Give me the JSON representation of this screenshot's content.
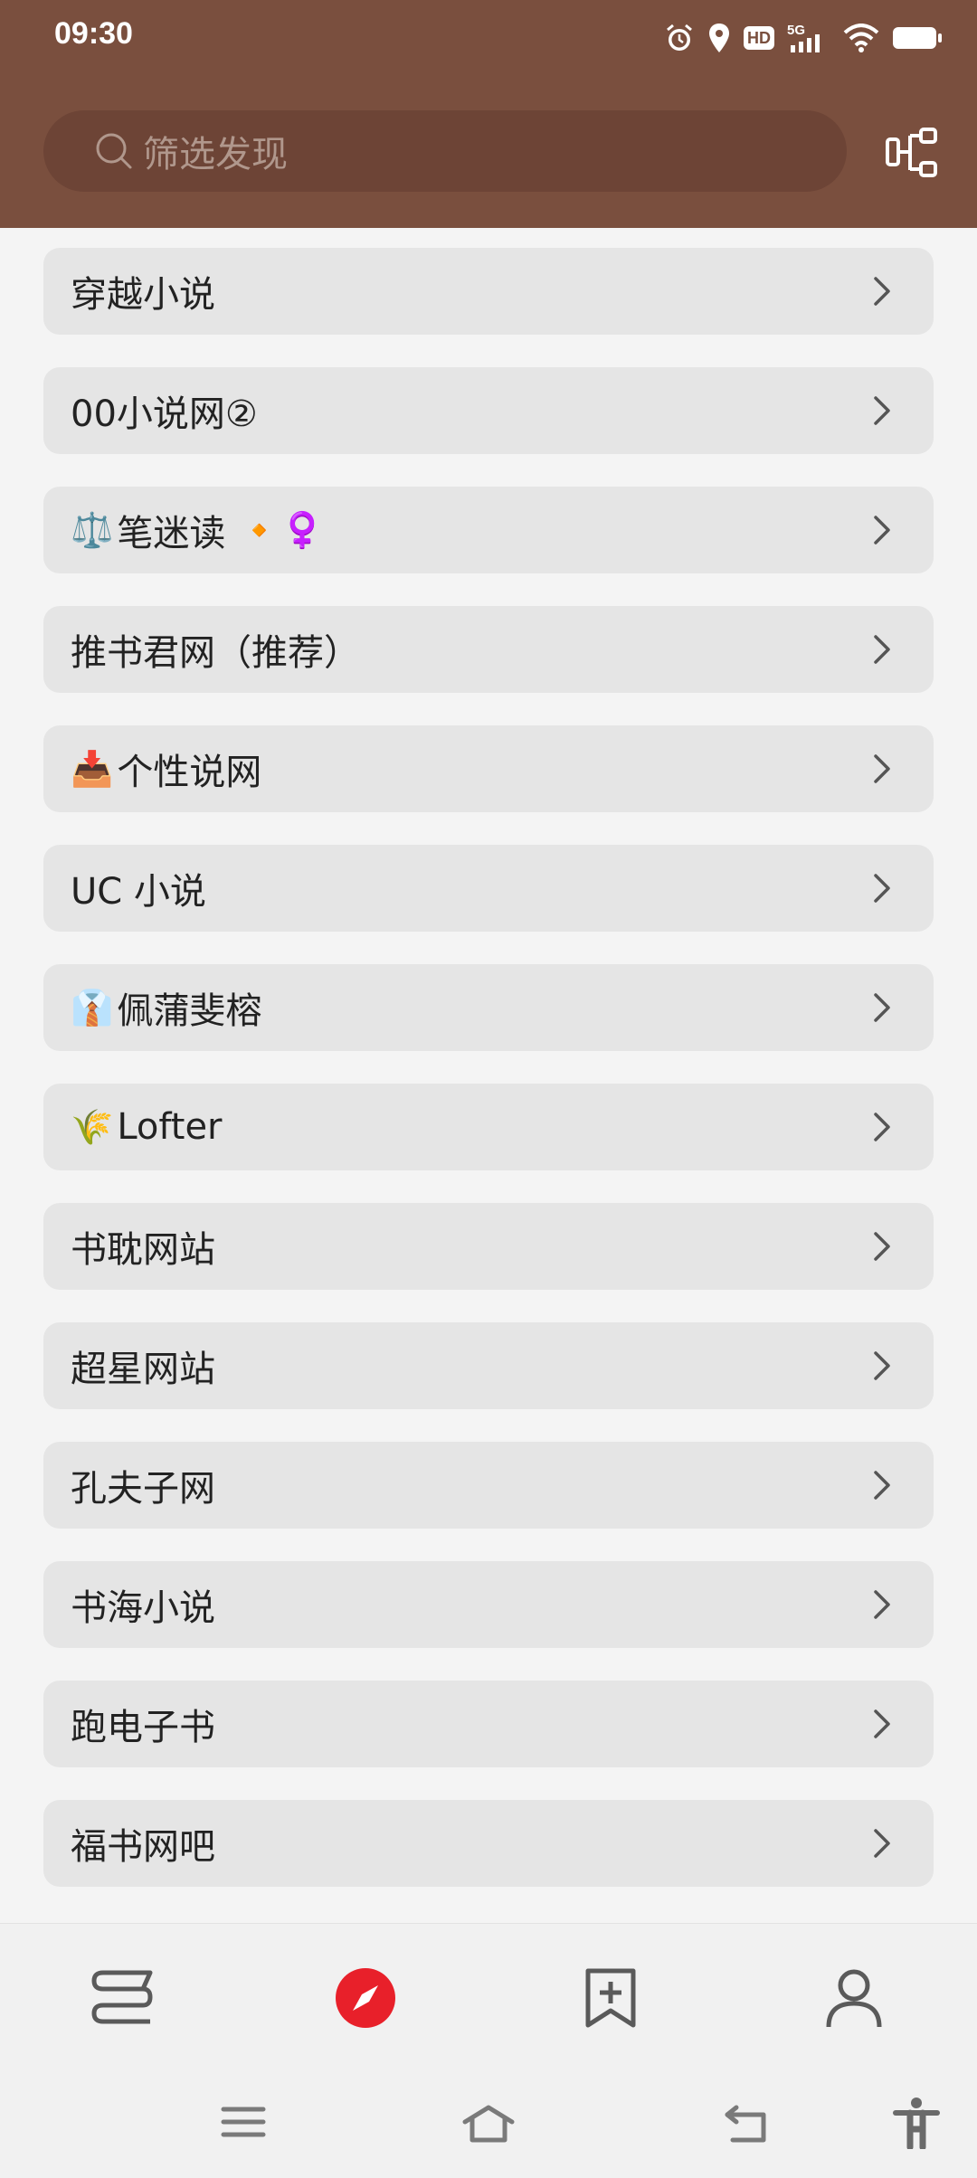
{
  "status_bar": {
    "time": "09:30",
    "hd": "HD",
    "network": "5G"
  },
  "search": {
    "placeholder": "筛选发现"
  },
  "list": {
    "items": [
      {
        "label": "穿越小说",
        "emoji": ""
      },
      {
        "label": "00小说网②",
        "emoji": ""
      },
      {
        "label": "笔迷读",
        "emoji": "⚖️",
        "suffix_emoji": "🔸♀️"
      },
      {
        "label": "推书君网（推荐）",
        "emoji": ""
      },
      {
        "label": "个性说网",
        "emoji": "📥"
      },
      {
        "label": "UC 小说",
        "emoji": ""
      },
      {
        "label": "佩蒲斐榕",
        "emoji": "👔"
      },
      {
        "label": "Lofter",
        "emoji": "🌾"
      },
      {
        "label": "书耽网站",
        "emoji": ""
      },
      {
        "label": "超星网站",
        "emoji": ""
      },
      {
        "label": "孔夫子网",
        "emoji": ""
      },
      {
        "label": "书海小说",
        "emoji": ""
      },
      {
        "label": "跑电子书",
        "emoji": ""
      },
      {
        "label": "福书网吧",
        "emoji": ""
      }
    ]
  },
  "bottom_nav": {
    "items": [
      {
        "icon": "bookshelf-icon",
        "active": false
      },
      {
        "icon": "compass-icon",
        "active": true
      },
      {
        "icon": "bookmark-add-icon",
        "active": false
      },
      {
        "icon": "person-icon",
        "active": false
      }
    ]
  },
  "colors": {
    "header": "#7a4f3e",
    "accent": "#e8202a",
    "card": "#e5e5e5"
  }
}
